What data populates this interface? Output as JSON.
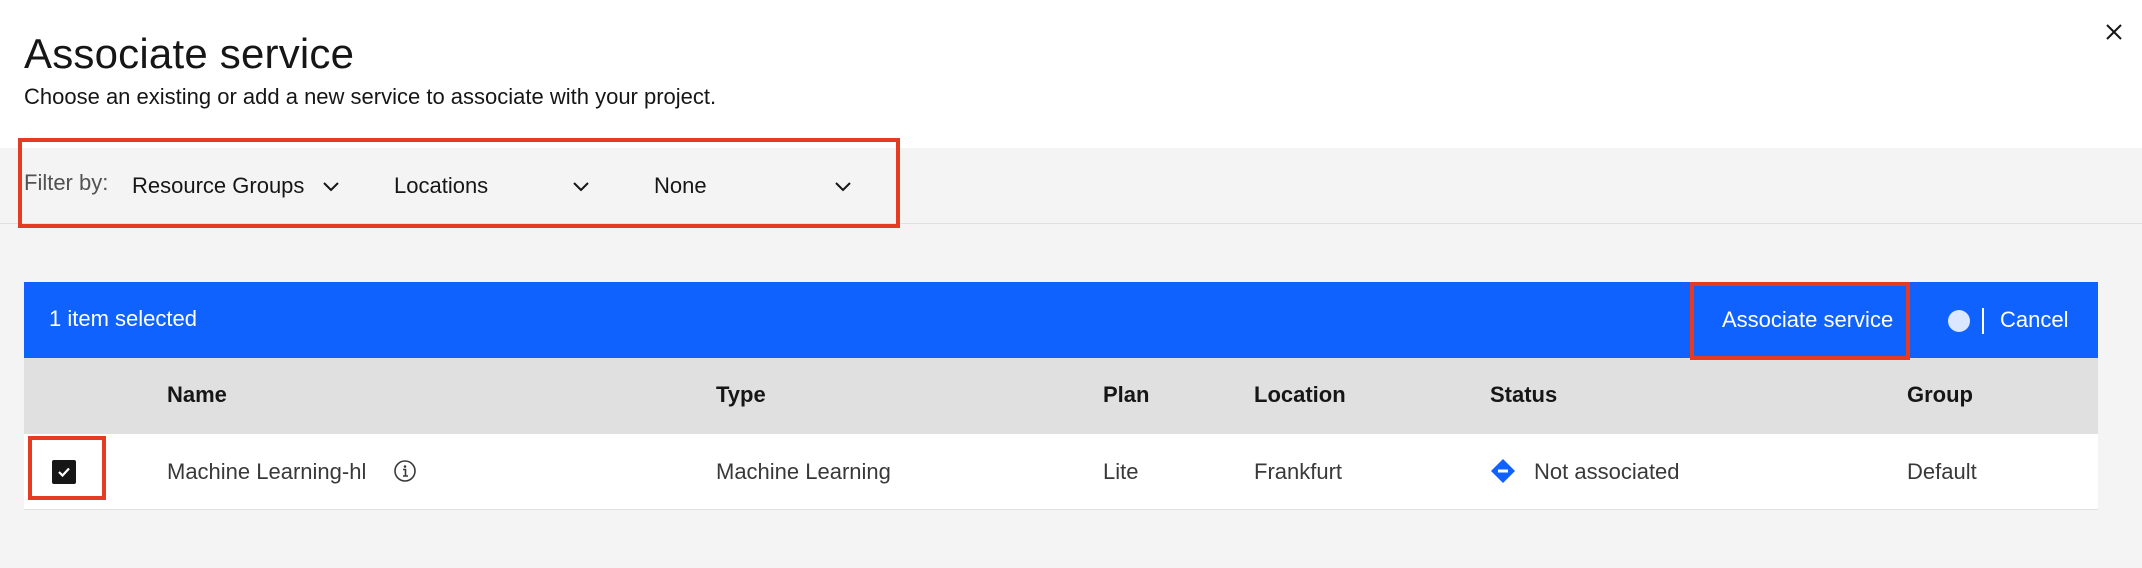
{
  "modal": {
    "title": "Associate service",
    "subtitle": "Choose an existing or add a new service to associate with your project."
  },
  "filters": {
    "label": "Filter by:",
    "resource_groups": "Resource Groups",
    "locations": "Locations",
    "none": "None"
  },
  "batch": {
    "selected_text": "1 item selected",
    "associate_label": "Associate service",
    "cancel_label": "Cancel"
  },
  "table": {
    "headers": {
      "name": "Name",
      "type": "Type",
      "plan": "Plan",
      "location": "Location",
      "status": "Status",
      "group": "Group"
    },
    "rows": [
      {
        "selected": true,
        "name": "Machine Learning-hl",
        "type": "Machine Learning",
        "plan": "Lite",
        "location": "Frankfurt",
        "status": "Not associated",
        "group": "Default"
      }
    ]
  },
  "colors": {
    "accent_blue": "#0f62fe",
    "highlight_red": "#e53b22",
    "status_icon_blue": "#0f62fe"
  },
  "icons": {
    "close": "close-icon",
    "chevron": "chevron-down-icon",
    "info": "info-icon",
    "checkmark": "checkmark-icon",
    "status": "diamond-status-icon"
  }
}
